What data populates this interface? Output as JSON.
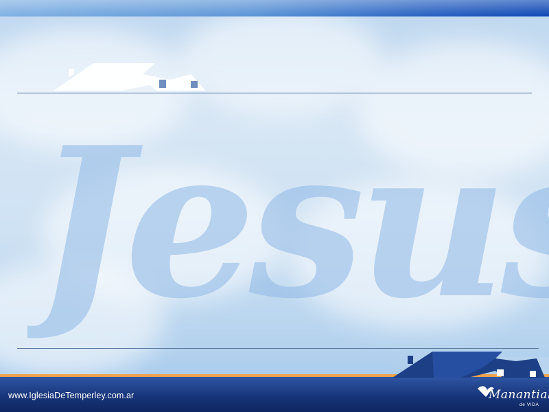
{
  "footer": {
    "url": "www.IglesiaDeTemperley.com.ar",
    "logo_title": "Manantial",
    "logo_subtitle": "de VIDA"
  },
  "watermark": {
    "text": "Jesus"
  },
  "colors": {
    "sky": "#cfe2f3",
    "top_strip_end": "#0c45b4",
    "footer_blue": "#18357a",
    "accent_orange": "#f0a24a",
    "watermark_blue": "#8fb8e6"
  },
  "icons": [
    "house-roof-icon",
    "house-roof-icon",
    "dove-icon"
  ]
}
